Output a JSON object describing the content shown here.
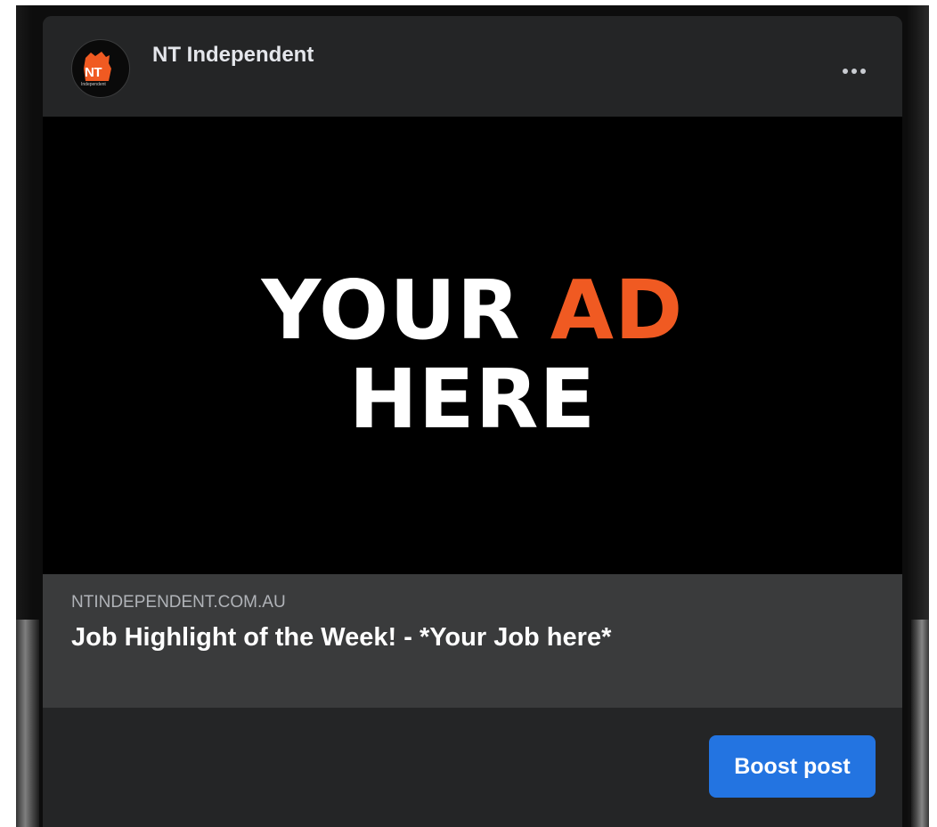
{
  "post": {
    "page_name": "NT Independent",
    "avatar": {
      "logo_text": "NT",
      "logo_subtext": "Independent",
      "accent_color": "#f05a22"
    },
    "more_icon": "more-horizontal-icon"
  },
  "ad_image": {
    "line1_word1": "YOUR",
    "line1_word2": "AD",
    "line2": "HERE",
    "accent_color": "#f05a22"
  },
  "link_preview": {
    "domain": "NTINDEPENDENT.COM.AU",
    "title": "Job Highlight of the Week! - *Your Job here*"
  },
  "actions": {
    "boost_label": "Boost post",
    "boost_color": "#2374e1"
  }
}
